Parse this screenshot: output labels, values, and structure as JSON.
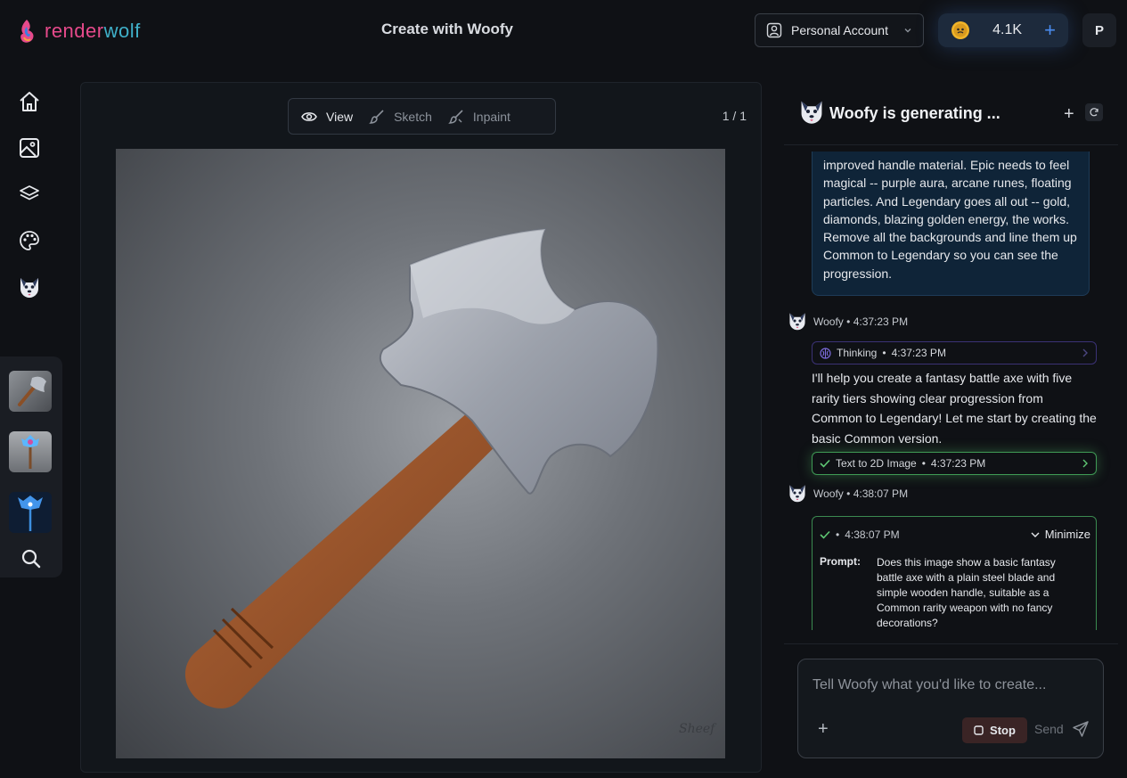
{
  "brand": {
    "name_part1": "render",
    "name_part2": "wolf"
  },
  "header": {
    "page_title": "Create with Woofy",
    "account_label": "Personal Account",
    "credits": "4.1K",
    "avatar_initial": "P"
  },
  "nav": [
    "home-icon",
    "image-icon",
    "layers-icon",
    "palette-icon",
    "woofy-icon",
    "search-icon"
  ],
  "canvas": {
    "modes": [
      {
        "label": "View",
        "icon": "eye-icon",
        "active": true
      },
      {
        "label": "Sketch",
        "icon": "brush-icon",
        "active": false
      },
      {
        "label": "Inpaint",
        "icon": "inpaint-brush-icon",
        "active": false
      }
    ],
    "page_count": "1 / 1",
    "signature": "Sheef"
  },
  "chat": {
    "title": "Woofy is generating ...",
    "user_message": "improved handle material. Epic needs to feel magical -- purple aura, arcane runes, floating particles. And Legendary goes all out -- gold, diamonds, blazing golden energy, the works. Remove all the backgrounds and line them up Common to Legendary so you can see the progression.",
    "messages": [
      {
        "author": "Woofy",
        "time": "4:37:23 PM",
        "thinking_label": "Thinking",
        "thinking_time": "4:37:23 PM",
        "text": "I'll help you create a fantasy battle axe with five rarity tiers showing clear progression from Common to Legendary! Let me start by creating the basic Common version.",
        "tool_label": "Text to 2D Image",
        "tool_time": "4:37:23 PM"
      },
      {
        "author": "Woofy",
        "time": "4:38:07 PM",
        "card_time": "4:38:07 PM",
        "minimize_label": "Minimize",
        "prompt_label": "Prompt:",
        "prompt_text": "Does this image show a basic fantasy battle axe with a plain steel blade and simple wooden handle, suitable as a Common rarity weapon with no fancy decorations?"
      }
    ],
    "sep": "•"
  },
  "composer": {
    "placeholder": "Tell Woofy what you'd like to create...",
    "stop_label": "Stop",
    "send_label": "Send"
  },
  "colors": {
    "accent_blue": "#4a8cf0",
    "success_green": "#3b8a50",
    "brand_pink": "#e64a8b",
    "brand_teal": "#3fb0c9"
  }
}
